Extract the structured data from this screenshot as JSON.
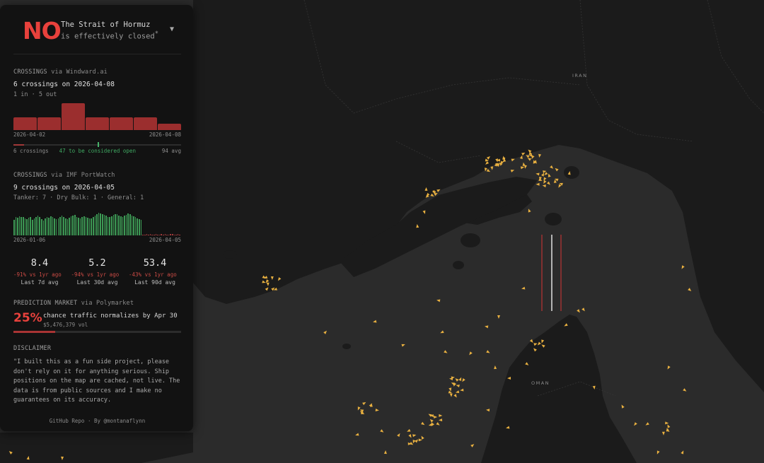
{
  "header": {
    "status": "NO",
    "title_line1": "The Strait of Hormuz",
    "title_line2": "is effectively closed",
    "title_mark": "*",
    "caret": "▼"
  },
  "windward": {
    "title": "CROSSINGS",
    "via": "via Windward.ai",
    "headline": "6 crossings on 2026-04-08",
    "inout": "1 in · 5 out",
    "bars": [
      3,
      3,
      6.5,
      3,
      3,
      3,
      1.6
    ],
    "axis_start": "2026-04-02",
    "axis_end": "2026-04-08",
    "current": 6,
    "threshold": 47,
    "avg": 94,
    "label_current": "6 crossings",
    "label_threshold": "47 to be considered open",
    "label_avg": "94 avg",
    "color_bar": "#9b2e2e"
  },
  "imf": {
    "title": "CROSSINGS",
    "via": "via IMF PortWatch",
    "headline": "9 crossings on 2026-04-05",
    "breakdown": "Tanker: 7 · Dry Bulk: 1 · General: 1",
    "axis_start": "2026-01-06",
    "axis_end": "2026-04-05",
    "series": [
      68,
      80,
      76,
      82,
      78,
      80,
      72,
      70,
      76,
      80,
      66,
      74,
      80,
      84,
      78,
      70,
      64,
      72,
      80,
      76,
      82,
      78,
      74,
      70,
      72,
      80,
      86,
      80,
      74,
      70,
      76,
      82,
      84,
      88,
      80,
      76,
      72,
      78,
      82,
      80,
      76,
      72,
      74,
      80,
      84,
      90,
      96,
      94,
      90,
      88,
      84,
      80,
      78,
      82,
      88,
      92,
      90,
      86,
      82,
      80,
      84,
      88,
      94,
      90,
      86,
      82,
      78,
      74,
      70,
      66,
      4,
      3,
      5,
      2,
      6,
      4,
      3,
      5,
      4,
      3,
      6,
      4,
      5,
      3,
      4,
      6,
      5,
      4,
      3,
      5,
      4
    ],
    "color_good": "#3d9a55",
    "color_bad": "#a33b3b"
  },
  "stats": [
    {
      "value": "8.4",
      "change": "-91% vs 1yr ago",
      "label": "Last 7d avg"
    },
    {
      "value": "5.2",
      "change": "-94% vs 1yr ago",
      "label": "Last 30d avg"
    },
    {
      "value": "53.4",
      "change": "-43% vs 1yr ago",
      "label": "Last 90d avg"
    }
  ],
  "prediction": {
    "title": "PREDICTION MARKET",
    "via": "via Polymarket",
    "pct": "25%",
    "probability": 0.25,
    "desc": "chance traffic normalizes by Apr 30",
    "vol": "$5,476,379 vol"
  },
  "disclaimer": {
    "title": "DISCLAIMER",
    "text": "\"I built this as a fun side project, please don't rely on it for anything serious. Ship positions on the map are cached, not live. The data is from public sources and I make no guarantees on its accuracy."
  },
  "footer": {
    "repo": "GitHub Repo",
    "sep": " · ",
    "by": "By @montanaflynn"
  },
  "map": {
    "place_iran": "IRAN",
    "place_oman": "OMAN",
    "sea_color": "#2b2b2b",
    "land_color": "#1b1b1b",
    "ship_color": "#e8b040",
    "border_color": "#2f2f2f",
    "gate_red": "#b03232",
    "gate_white": "#c4c4c4"
  }
}
